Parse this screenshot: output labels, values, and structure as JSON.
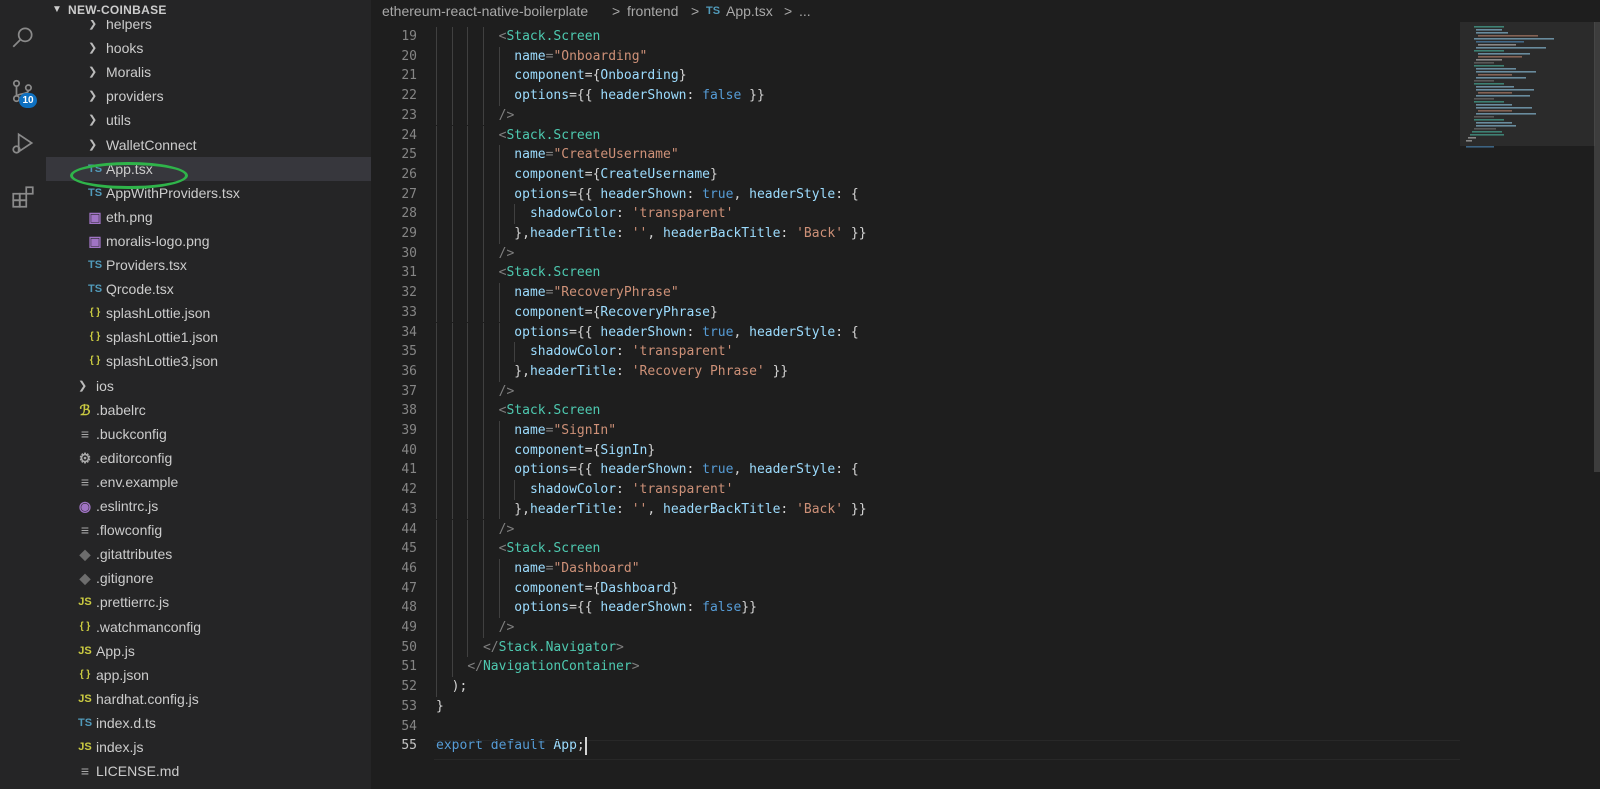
{
  "explorer": {
    "title": "NEW-COINBASE",
    "items": [
      {
        "label": "helpers",
        "type": "folder",
        "depth": 1
      },
      {
        "label": "hooks",
        "type": "folder",
        "depth": 1
      },
      {
        "label": "Moralis",
        "type": "folder",
        "depth": 1
      },
      {
        "label": "providers",
        "type": "folder",
        "depth": 1
      },
      {
        "label": "utils",
        "type": "folder",
        "depth": 1
      },
      {
        "label": "WalletConnect",
        "type": "folder",
        "depth": 1
      },
      {
        "label": "App.tsx",
        "type": "ts",
        "depth": 1,
        "selected": true
      },
      {
        "label": "AppWithProviders.tsx",
        "type": "ts",
        "depth": 1
      },
      {
        "label": "eth.png",
        "type": "image",
        "depth": 1
      },
      {
        "label": "moralis-logo.png",
        "type": "image",
        "depth": 1
      },
      {
        "label": "Providers.tsx",
        "type": "ts",
        "depth": 1
      },
      {
        "label": "Qrcode.tsx",
        "type": "ts",
        "depth": 1
      },
      {
        "label": "splashLottie.json",
        "type": "json",
        "depth": 1
      },
      {
        "label": "splashLottie1.json",
        "type": "json",
        "depth": 1
      },
      {
        "label": "splashLottie3.json",
        "type": "json",
        "depth": 1
      },
      {
        "label": "ios",
        "type": "folder",
        "depth": 0
      },
      {
        "label": ".babelrc",
        "type": "babel",
        "depth": 0
      },
      {
        "label": ".buckconfig",
        "type": "lines",
        "depth": 0
      },
      {
        "label": ".editorconfig",
        "type": "gear",
        "depth": 0
      },
      {
        "label": ".env.example",
        "type": "lines",
        "depth": 0
      },
      {
        "label": ".eslintrc.js",
        "type": "eslint",
        "depth": 0
      },
      {
        "label": ".flowconfig",
        "type": "lines",
        "depth": 0
      },
      {
        "label": ".gitattributes",
        "type": "git",
        "depth": 0
      },
      {
        "label": ".gitignore",
        "type": "git",
        "depth": 0
      },
      {
        "label": ".prettierrc.js",
        "type": "js",
        "depth": 0
      },
      {
        "label": ".watchmanconfig",
        "type": "json",
        "depth": 0
      },
      {
        "label": "App.js",
        "type": "js",
        "depth": 0
      },
      {
        "label": "app.json",
        "type": "json",
        "depth": 0
      },
      {
        "label": "hardhat.config.js",
        "type": "js",
        "depth": 0
      },
      {
        "label": "index.d.ts",
        "type": "ts",
        "depth": 0
      },
      {
        "label": "index.js",
        "type": "js",
        "depth": 0
      },
      {
        "label": "LICENSE.md",
        "type": "lines",
        "depth": 0
      }
    ]
  },
  "activity": {
    "scm_badge": "10",
    "icons": [
      "search-icon",
      "source-control-icon",
      "run-debug-icon",
      "extensions-icon"
    ]
  },
  "breadcrumb": {
    "parts": [
      "ethereum-react-native-boilerplate",
      "frontend",
      "App.tsx",
      "..."
    ],
    "separator": ">",
    "file_badge": "TS"
  },
  "editor": {
    "current_line": 55,
    "lines": [
      {
        "n": 19,
        "indent": 8,
        "tokens": [
          [
            "p",
            "<"
          ],
          [
            "t",
            "Stack.Screen"
          ]
        ]
      },
      {
        "n": 20,
        "indent": 10,
        "tokens": [
          [
            "a",
            "name"
          ],
          [
            "p",
            "="
          ],
          [
            "s",
            "\"Onboarding\""
          ]
        ]
      },
      {
        "n": 21,
        "indent": 10,
        "tokens": [
          [
            "a",
            "component"
          ],
          [
            "p",
            "={"
          ],
          [
            "v",
            "Onboarding"
          ],
          [
            "p",
            "}"
          ]
        ]
      },
      {
        "n": 22,
        "indent": 10,
        "tokens": [
          [
            "a",
            "options"
          ],
          [
            "p",
            "={{ "
          ],
          [
            "v",
            "headerShown"
          ],
          [
            "p",
            ": "
          ],
          [
            "k",
            "false"
          ],
          [
            "p",
            " }}"
          ]
        ]
      },
      {
        "n": 23,
        "indent": 8,
        "tokens": [
          [
            "p",
            "/>"
          ]
        ]
      },
      {
        "n": 24,
        "indent": 8,
        "tokens": [
          [
            "p",
            "<"
          ],
          [
            "t",
            "Stack.Screen"
          ]
        ]
      },
      {
        "n": 25,
        "indent": 10,
        "tokens": [
          [
            "a",
            "name"
          ],
          [
            "p",
            "="
          ],
          [
            "s",
            "\"CreateUsername\""
          ]
        ]
      },
      {
        "n": 26,
        "indent": 10,
        "tokens": [
          [
            "a",
            "component"
          ],
          [
            "p",
            "={"
          ],
          [
            "v",
            "CreateUsername"
          ],
          [
            "p",
            "}"
          ]
        ]
      },
      {
        "n": 27,
        "indent": 10,
        "tokens": [
          [
            "a",
            "options"
          ],
          [
            "p",
            "={{ "
          ],
          [
            "v",
            "headerShown"
          ],
          [
            "p",
            ": "
          ],
          [
            "k",
            "true"
          ],
          [
            "p",
            ", "
          ],
          [
            "v",
            "headerStyle"
          ],
          [
            "p",
            ": {"
          ]
        ]
      },
      {
        "n": 28,
        "indent": 12,
        "tokens": [
          [
            "v",
            "shadowColor"
          ],
          [
            "p",
            ": "
          ],
          [
            "s",
            "'transparent'"
          ]
        ]
      },
      {
        "n": 29,
        "indent": 10,
        "tokens": [
          [
            "p",
            "},"
          ],
          [
            "v",
            "headerTitle"
          ],
          [
            "p",
            ": "
          ],
          [
            "s",
            "''"
          ],
          [
            "p",
            ", "
          ],
          [
            "v",
            "headerBackTitle"
          ],
          [
            "p",
            ": "
          ],
          [
            "s",
            "'Back'"
          ],
          [
            "p",
            " }}"
          ]
        ]
      },
      {
        "n": 30,
        "indent": 8,
        "tokens": [
          [
            "p",
            "/>"
          ]
        ]
      },
      {
        "n": 31,
        "indent": 8,
        "tokens": [
          [
            "p",
            "<"
          ],
          [
            "t",
            "Stack.Screen"
          ]
        ]
      },
      {
        "n": 32,
        "indent": 10,
        "tokens": [
          [
            "a",
            "name"
          ],
          [
            "p",
            "="
          ],
          [
            "s",
            "\"RecoveryPhrase\""
          ]
        ]
      },
      {
        "n": 33,
        "indent": 10,
        "tokens": [
          [
            "a",
            "component"
          ],
          [
            "p",
            "={"
          ],
          [
            "v",
            "RecoveryPhrase"
          ],
          [
            "p",
            "}"
          ]
        ]
      },
      {
        "n": 34,
        "indent": 10,
        "tokens": [
          [
            "a",
            "options"
          ],
          [
            "p",
            "={{ "
          ],
          [
            "v",
            "headerShown"
          ],
          [
            "p",
            ": "
          ],
          [
            "k",
            "true"
          ],
          [
            "p",
            ", "
          ],
          [
            "v",
            "headerStyle"
          ],
          [
            "p",
            ": {"
          ]
        ]
      },
      {
        "n": 35,
        "indent": 12,
        "tokens": [
          [
            "v",
            "shadowColor"
          ],
          [
            "p",
            ": "
          ],
          [
            "s",
            "'transparent'"
          ]
        ]
      },
      {
        "n": 36,
        "indent": 10,
        "tokens": [
          [
            "p",
            "},"
          ],
          [
            "v",
            "headerTitle"
          ],
          [
            "p",
            ": "
          ],
          [
            "s",
            "'Recovery Phrase'"
          ],
          [
            "p",
            " }}"
          ]
        ]
      },
      {
        "n": 37,
        "indent": 8,
        "tokens": [
          [
            "p",
            "/>"
          ]
        ]
      },
      {
        "n": 38,
        "indent": 8,
        "tokens": [
          [
            "p",
            "<"
          ],
          [
            "t",
            "Stack.Screen"
          ]
        ]
      },
      {
        "n": 39,
        "indent": 10,
        "tokens": [
          [
            "a",
            "name"
          ],
          [
            "p",
            "="
          ],
          [
            "s",
            "\"SignIn\""
          ]
        ]
      },
      {
        "n": 40,
        "indent": 10,
        "tokens": [
          [
            "a",
            "component"
          ],
          [
            "p",
            "={"
          ],
          [
            "v",
            "SignIn"
          ],
          [
            "p",
            "}"
          ]
        ]
      },
      {
        "n": 41,
        "indent": 10,
        "tokens": [
          [
            "a",
            "options"
          ],
          [
            "p",
            "={{ "
          ],
          [
            "v",
            "headerShown"
          ],
          [
            "p",
            ": "
          ],
          [
            "k",
            "true"
          ],
          [
            "p",
            ", "
          ],
          [
            "v",
            "headerStyle"
          ],
          [
            "p",
            ": {"
          ]
        ]
      },
      {
        "n": 42,
        "indent": 12,
        "tokens": [
          [
            "v",
            "shadowColor"
          ],
          [
            "p",
            ": "
          ],
          [
            "s",
            "'transparent'"
          ]
        ]
      },
      {
        "n": 43,
        "indent": 10,
        "tokens": [
          [
            "p",
            "},"
          ],
          [
            "v",
            "headerTitle"
          ],
          [
            "p",
            ": "
          ],
          [
            "s",
            "''"
          ],
          [
            "p",
            ", "
          ],
          [
            "v",
            "headerBackTitle"
          ],
          [
            "p",
            ": "
          ],
          [
            "s",
            "'Back'"
          ],
          [
            "p",
            " }}"
          ]
        ]
      },
      {
        "n": 44,
        "indent": 8,
        "tokens": [
          [
            "p",
            "/>"
          ]
        ]
      },
      {
        "n": 45,
        "indent": 8,
        "tokens": [
          [
            "p",
            "<"
          ],
          [
            "t",
            "Stack.Screen"
          ]
        ]
      },
      {
        "n": 46,
        "indent": 10,
        "tokens": [
          [
            "a",
            "name"
          ],
          [
            "p",
            "="
          ],
          [
            "s",
            "\"Dashboard\""
          ]
        ]
      },
      {
        "n": 47,
        "indent": 10,
        "tokens": [
          [
            "a",
            "component"
          ],
          [
            "p",
            "={"
          ],
          [
            "v",
            "Dashboard"
          ],
          [
            "p",
            "}"
          ]
        ]
      },
      {
        "n": 48,
        "indent": 10,
        "tokens": [
          [
            "a",
            "options"
          ],
          [
            "p",
            "={{ "
          ],
          [
            "v",
            "headerShown"
          ],
          [
            "p",
            ": "
          ],
          [
            "k",
            "false"
          ],
          [
            "p",
            "}}"
          ]
        ]
      },
      {
        "n": 49,
        "indent": 8,
        "tokens": [
          [
            "p",
            "/>"
          ]
        ]
      },
      {
        "n": 50,
        "indent": 6,
        "tokens": [
          [
            "p",
            "</"
          ],
          [
            "t",
            "Stack.Navigator"
          ],
          [
            "p",
            ">"
          ]
        ]
      },
      {
        "n": 51,
        "indent": 4,
        "tokens": [
          [
            "p",
            "</"
          ],
          [
            "t",
            "NavigationContainer"
          ],
          [
            "p",
            ">"
          ]
        ]
      },
      {
        "n": 52,
        "indent": 2,
        "tokens": [
          [
            "p",
            ");"
          ]
        ]
      },
      {
        "n": 53,
        "indent": 0,
        "tokens": [
          [
            "p",
            "}"
          ]
        ]
      },
      {
        "n": 54,
        "indent": 0,
        "tokens": []
      },
      {
        "n": 55,
        "indent": 0,
        "tokens": [
          [
            "kc",
            "export"
          ],
          [
            "p",
            " "
          ],
          [
            "kc",
            "default"
          ],
          [
            "p",
            " "
          ],
          [
            "v",
            "App"
          ],
          [
            "p",
            ";"
          ]
        ]
      }
    ]
  },
  "colors": {
    "tag": "#4ec9b0",
    "attr": "#9cdcfe",
    "string": "#ce9178",
    "keyword": "#569cd6",
    "control": "#c586c0",
    "punct": "#808080",
    "plain": "#d4d4d4",
    "ts_icon": "#519aba",
    "js_icon": "#cbcb41",
    "json_icon": "#cbcb41",
    "image_icon": "#a074c4",
    "highlight_circle": "#2fb44a"
  }
}
